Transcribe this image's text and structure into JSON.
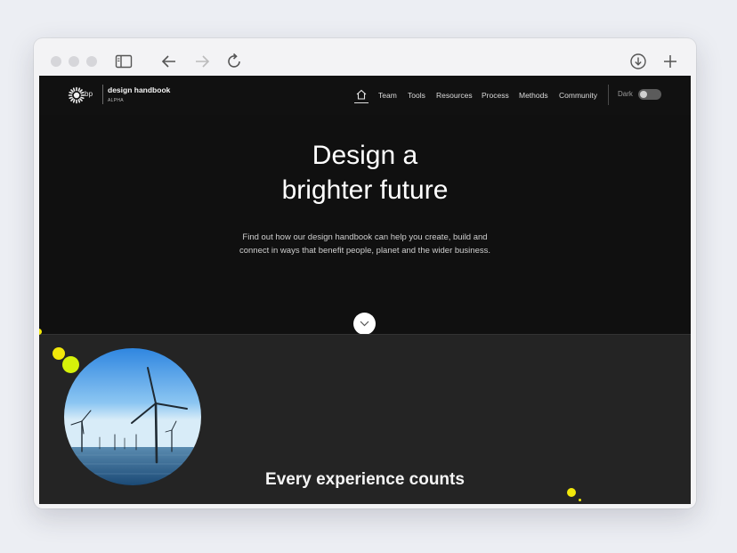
{
  "browser": {
    "icons": [
      "sidebar-icon",
      "back-arrow-icon",
      "forward-arrow-icon",
      "reload-icon",
      "download-icon",
      "new-tab-plus-icon"
    ]
  },
  "site": {
    "logo_text": "bp",
    "brand_title": "design handbook",
    "brand_subtitle": "ALPHA",
    "nav": [
      "Team",
      "Tools",
      "Resources",
      "Process",
      "Methods",
      "Community"
    ],
    "theme_toggle_label": "Dark",
    "theme_toggle_on": false
  },
  "hero": {
    "title_line1": "Design a",
    "title_line2": "brighter future",
    "subtitle_line1": "Find out how our design handbook can help you create, build and",
    "subtitle_line2": "connect in ways that benefit people, planet and the wider business."
  },
  "section": {
    "title": "Every experience counts"
  },
  "colors": {
    "accent_yellow": "#f2e80a",
    "accent_lime": "#d6f20a",
    "background_dark": "#101010",
    "section_dark": "#242424"
  }
}
